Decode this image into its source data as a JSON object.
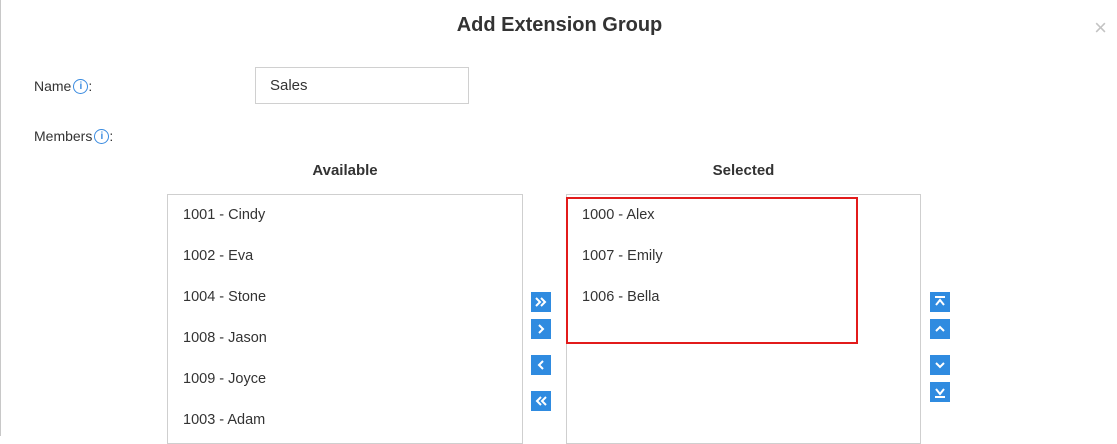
{
  "dialog": {
    "title": "Add Extension Group",
    "close_glyph": "×"
  },
  "name_field": {
    "label": "Name",
    "suffix": ":",
    "info_glyph": "i",
    "value": "Sales"
  },
  "members": {
    "label": "Members",
    "suffix": ":",
    "info_glyph": "i"
  },
  "available": {
    "header": "Available",
    "items": [
      "1001 - Cindy",
      "1002 - Eva",
      "1004 - Stone",
      "1008 - Jason",
      "1009 - Joyce",
      "1003 - Adam"
    ]
  },
  "selected": {
    "header": "Selected",
    "items": [
      "1000 - Alex",
      "1007 - Emily",
      "1006 - Bella"
    ]
  },
  "colors": {
    "accent": "#2f8be0",
    "highlight_border": "#e21b1b",
    "list_border": "#cfcfcf"
  },
  "icons": {
    "transfer": [
      "double-chevron-right-icon",
      "chevron-right-icon",
      "chevron-left-icon",
      "double-chevron-left-icon"
    ],
    "order": [
      "move-to-top-icon",
      "chevron-up-icon",
      "chevron-down-icon",
      "move-to-bottom-icon"
    ]
  }
}
